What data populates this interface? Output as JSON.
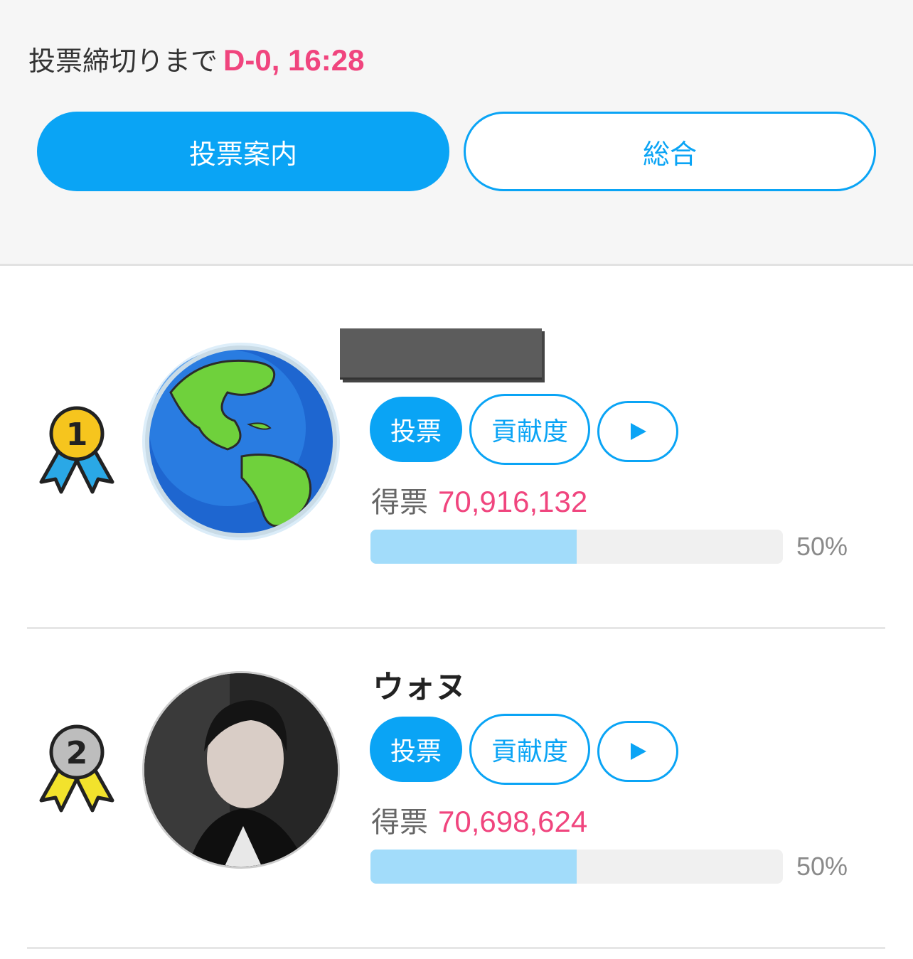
{
  "header": {
    "deadline_label": "投票締切りまで",
    "deadline_value": "D-0, 16:28",
    "tabs": [
      {
        "label": "投票案内",
        "active": true
      },
      {
        "label": "総合",
        "active": false
      }
    ]
  },
  "colors": {
    "accent_blue": "#0aa4f5",
    "accent_pink": "#f0457e",
    "progress_fill": "#a2dcfa"
  },
  "candidates": [
    {
      "rank": "1",
      "name": "",
      "name_redacted": true,
      "avatar_icon": "globe-icon",
      "vote_label": "投票",
      "contribution_label": "貢献度",
      "play_icon": "play-icon",
      "score_label": "得票",
      "score": "70,916,132",
      "percent_label": "50%",
      "percent": 0.5
    },
    {
      "rank": "2",
      "name": "ウォヌ",
      "name_redacted": false,
      "avatar_icon": "person-photo",
      "vote_label": "投票",
      "contribution_label": "貢献度",
      "play_icon": "play-icon",
      "score_label": "得票",
      "score": "70,698,624",
      "percent_label": "50%",
      "percent": 0.5
    }
  ]
}
